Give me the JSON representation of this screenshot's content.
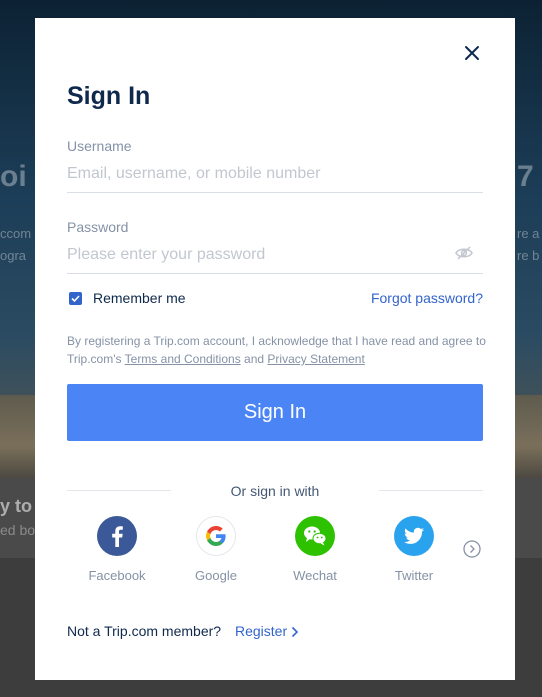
{
  "background": {
    "headline_left": "oi",
    "headline_right": "7",
    "line1_left": "ccom",
    "line1_right": "re a",
    "line2_left": "ogra",
    "line2_right": "re b",
    "band_title": "y to s",
    "band_sub": "ed bo"
  },
  "modal": {
    "title": "Sign In",
    "username": {
      "label": "Username",
      "placeholder": "Email, username, or mobile number",
      "value": ""
    },
    "password": {
      "label": "Password",
      "placeholder": "Please enter your password",
      "value": ""
    },
    "remember_me": {
      "label": "Remember me",
      "checked": true
    },
    "forgot_password": "Forgot password?",
    "agreement": {
      "prefix": "By registering a Trip.com account, I acknowledge that I have read and agree to Trip.com's",
      "terms": "Terms and Conditions",
      "and": "and",
      "privacy": "Privacy Statement"
    },
    "sign_in_button": "Sign In",
    "or_sign_in_with": "Or sign in with",
    "social": [
      {
        "name": "Facebook",
        "icon": "facebook-icon",
        "color": "#3b5998"
      },
      {
        "name": "Google",
        "icon": "google-icon",
        "color": "#ffffff"
      },
      {
        "name": "Wechat",
        "icon": "wechat-icon",
        "color": "#2dc100"
      },
      {
        "name": "Twitter",
        "icon": "twitter-icon",
        "color": "#2aa3ef"
      }
    ],
    "not_member": "Not a Trip.com member?",
    "register": "Register"
  },
  "colors": {
    "primary_button": "#4b85f5",
    "link": "#3264cc",
    "title": "#0f294d"
  }
}
